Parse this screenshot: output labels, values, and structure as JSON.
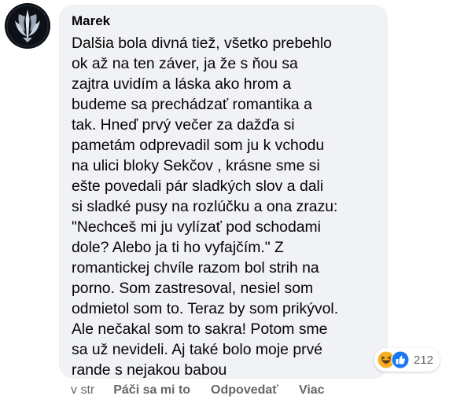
{
  "comment": {
    "author": "Marek",
    "text": "Dalšia bola divná tiež, všetko prebehlo\nok až na ten záver, ja že s ňou sa\nzajtra uvidím a láska ako hrom a\nbudeme sa prechádzať romantika a\ntak. Hneď prvý večer za dažďa si\npametám odprevadil som ju k vchodu\nna ulici bloky Sekčov , krásne sme si\nešte povedali pár sladkých slov a dali\nsi sladké pusy na rozlúčku a ona zrazu:\n\"Nechceš mi ju vylízať pod schodami\ndole? Alebo ja ti ho vyfajčím.\" Z\nromantickej chvíle razom bol strih na\nporno. Som zastresoval, nesiel som\nodmietol som to. Teraz by som prikývol.\nAle nečakal som to sakra! Potom sme\nsa už nevideli. Aj také bolo moje prvé\nrande s nejakou babou",
    "reaction_count": "212",
    "reaction_icons": [
      "haha-icon",
      "like-icon"
    ]
  },
  "actions": {
    "time": "v str",
    "like": "Páči sa mi to",
    "reply": "Odpovedať",
    "more": "Viac"
  },
  "colors": {
    "bubble": "#f0f2f5",
    "like_blue": "#1877f2",
    "haha_yellow": "#f7b125",
    "muted_text": "#65676b"
  }
}
